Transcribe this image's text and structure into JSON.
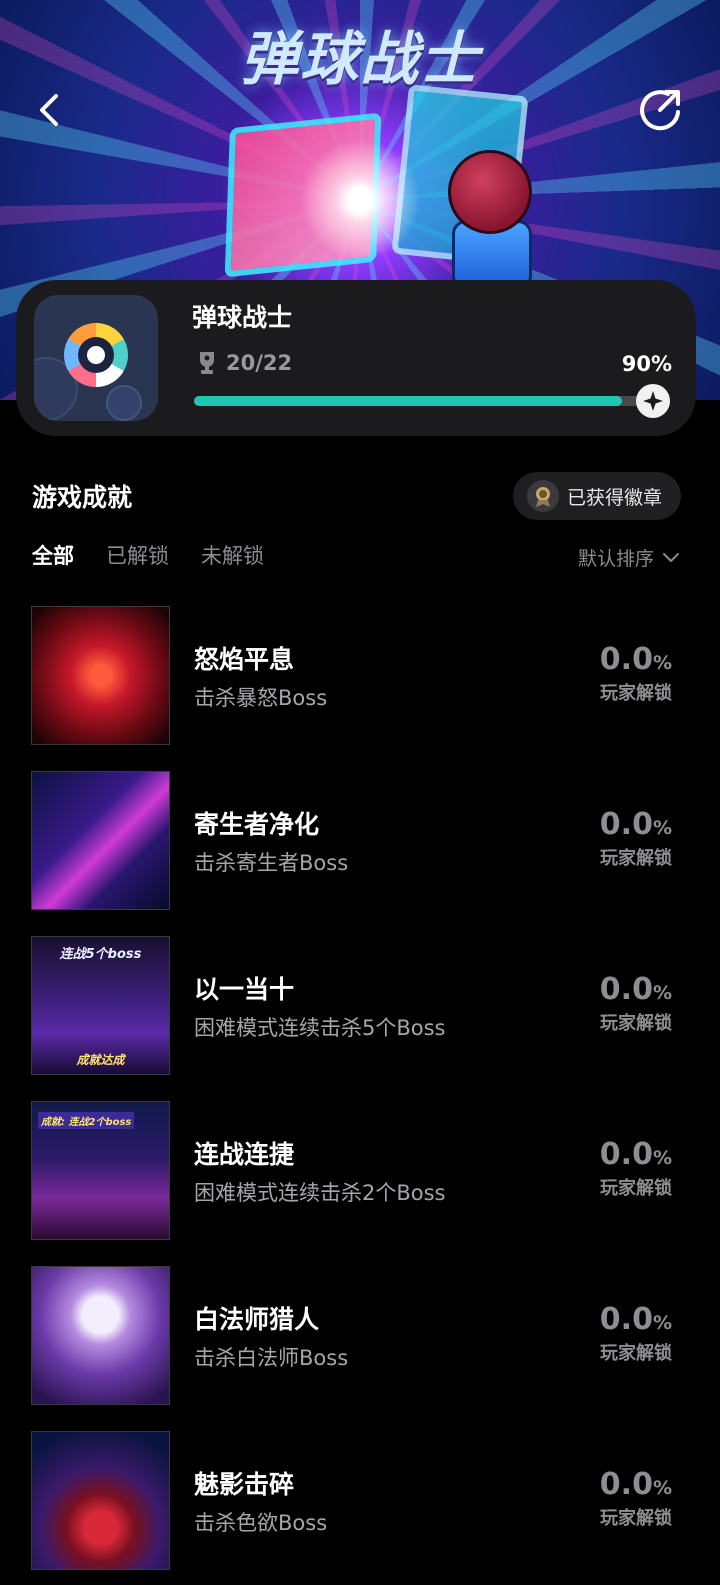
{
  "banner": {
    "title": "弹球战士"
  },
  "game": {
    "name": "弹球战士",
    "trophy_count": "20/22",
    "percent_label": "90%",
    "progress": 0.9
  },
  "section": {
    "title": "游戏成就",
    "badge_button": "已获得徽章"
  },
  "tabs": [
    {
      "label": "全部",
      "active": true
    },
    {
      "label": "已解锁",
      "active": false
    },
    {
      "label": "未解锁",
      "active": false
    }
  ],
  "sort": {
    "label": "默认排序"
  },
  "achievements": [
    {
      "title": "怒焰平息",
      "desc": "击杀暴怒Boss",
      "rate": "0.0",
      "pct": "%",
      "label": "玩家解锁",
      "thumb_caption": ""
    },
    {
      "title": "寄生者净化",
      "desc": "击杀寄生者Boss",
      "rate": "0.0",
      "pct": "%",
      "label": "玩家解锁",
      "thumb_caption": ""
    },
    {
      "title": "以一当十",
      "desc": "困难模式连续击杀5个Boss",
      "rate": "0.0",
      "pct": "%",
      "label": "玩家解锁",
      "thumb_caption": "连战5个boss",
      "thumb_caption2": "成就达成"
    },
    {
      "title": "连战连捷",
      "desc": "困难模式连续击杀2个Boss",
      "rate": "0.0",
      "pct": "%",
      "label": "玩家解锁",
      "thumb_caption": "成就: 连战2个boss"
    },
    {
      "title": "白法师猎人",
      "desc": "击杀白法师Boss",
      "rate": "0.0",
      "pct": "%",
      "label": "玩家解锁",
      "thumb_caption": ""
    },
    {
      "title": "魅影击碎",
      "desc": "击杀色欲Boss",
      "rate": "0.0",
      "pct": "%",
      "label": "玩家解锁",
      "thumb_caption": ""
    }
  ],
  "colors": {
    "accent": "#1fc7b2",
    "card": "#1b1b1d",
    "muted": "#8e8e92"
  }
}
